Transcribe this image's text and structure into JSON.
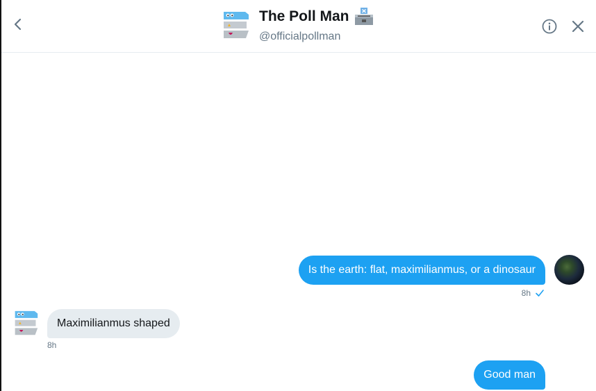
{
  "header": {
    "title": "The Poll Man",
    "handle": "@officialpollman",
    "title_emoji": "ballot-box-icon"
  },
  "messages": [
    {
      "direction": "sent",
      "text": "Is the earth: flat, maximilianmus,  or a dinosaur",
      "time": "8h",
      "status": "read-check"
    },
    {
      "direction": "received",
      "text": "Maximilianmus shaped",
      "time": "8h"
    },
    {
      "direction": "sent",
      "text": "Good man"
    }
  ],
  "colors": {
    "accent": "#1da1f2",
    "received_bubble": "#e6ecf0",
    "meta": "#657786"
  }
}
